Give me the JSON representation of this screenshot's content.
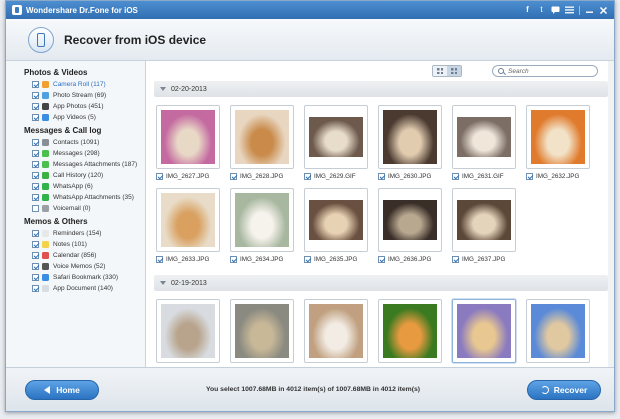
{
  "window": {
    "title": "Wondershare Dr.Fone for iOS",
    "icons": [
      "facebook-icon",
      "twitter-icon",
      "chat-icon",
      "menu-icon",
      "minimize-icon",
      "close-icon"
    ]
  },
  "header": {
    "title": "Recover from iOS device"
  },
  "search": {
    "placeholder": "Search"
  },
  "sidebar": {
    "sections": [
      {
        "title": "Photos & Videos",
        "items": [
          {
            "label": "Camera Roll (117)",
            "checked": true,
            "selected": true,
            "icon": "camera-roll-icon",
            "color": "#f0a030"
          },
          {
            "label": "Photo Stream (69)",
            "checked": true,
            "icon": "photo-stream-icon",
            "color": "#4ea0e0"
          },
          {
            "label": "App Photos (451)",
            "checked": true,
            "icon": "app-photos-icon",
            "color": "#444444"
          },
          {
            "label": "App Videos (5)",
            "checked": true,
            "icon": "app-videos-icon",
            "color": "#3a8de0"
          }
        ]
      },
      {
        "title": "Messages & Call log",
        "items": [
          {
            "label": "Contacts (1091)",
            "checked": true,
            "icon": "contacts-icon",
            "color": "#8a8f96"
          },
          {
            "label": "Messages (298)",
            "checked": true,
            "icon": "messages-icon",
            "color": "#4cc04c"
          },
          {
            "label": "Messages Attachments (187)",
            "checked": true,
            "icon": "attachments-icon",
            "color": "#4cc04c"
          },
          {
            "label": "Call History (120)",
            "checked": true,
            "icon": "call-history-icon",
            "color": "#3cb043"
          },
          {
            "label": "WhatsApp (6)",
            "checked": true,
            "icon": "whatsapp-icon",
            "color": "#2fb34a"
          },
          {
            "label": "WhatsApp Attachments (35)",
            "checked": true,
            "icon": "whatsapp-attachments-icon",
            "color": "#2fb34a"
          },
          {
            "label": "Voicemail (0)",
            "checked": false,
            "icon": "voicemail-icon",
            "color": "#9aa0a6"
          }
        ]
      },
      {
        "title": "Memos & Others",
        "items": [
          {
            "label": "Reminders (154)",
            "checked": true,
            "icon": "reminders-icon",
            "color": "#e8e8e8"
          },
          {
            "label": "Notes (101)",
            "checked": true,
            "icon": "notes-icon",
            "color": "#f2d34a"
          },
          {
            "label": "Calendar (856)",
            "checked": true,
            "icon": "calendar-icon",
            "color": "#e05050"
          },
          {
            "label": "Voice Memos (52)",
            "checked": true,
            "icon": "voice-memos-icon",
            "color": "#555555"
          },
          {
            "label": "Safari Bookmark (330)",
            "checked": true,
            "icon": "safari-icon",
            "color": "#3a8de0"
          },
          {
            "label": "App Document (140)",
            "checked": true,
            "icon": "app-document-icon",
            "color": "#d8dde2"
          }
        ]
      }
    ]
  },
  "groups": [
    {
      "date": "02-20-2013",
      "rows": [
        [
          {
            "name": "IMG_2627.JPG",
            "bg": "#c46aa0",
            "fg": "#e8d8c6"
          },
          {
            "name": "IMG_2628.JPG",
            "bg": "#e8d6c0",
            "fg": "#c98a4a"
          },
          {
            "name": "IMG_2629.GIF",
            "bg": "#6d5a4c",
            "fg": "#e8dccb",
            "wide": true
          },
          {
            "name": "IMG_2630.JPG",
            "bg": "#4a3a30",
            "fg": "#e2ccb0"
          },
          {
            "name": "IMG_2631.GIF",
            "bg": "#7c6e64",
            "fg": "#f0e6da",
            "wide": true
          },
          {
            "name": "IMG_2632.JPG",
            "bg": "#e07a2c",
            "fg": "#f2e2c8"
          }
        ],
        [
          {
            "name": "IMG_2633.JPG",
            "bg": "#e8dcc8",
            "fg": "#d9a060"
          },
          {
            "name": "IMG_2634.JPG",
            "bg": "#a8b8a0",
            "fg": "#f6f2ec"
          },
          {
            "name": "IMG_2635.JPG",
            "bg": "#6a5040",
            "fg": "#e8d2b4",
            "wide": true
          },
          {
            "name": "IMG_2636.JPG",
            "bg": "#3a2e28",
            "fg": "#b8a890",
            "wide": true
          },
          {
            "name": "IMG_2637.JPG",
            "bg": "#5c4838",
            "fg": "#e4d4bc",
            "wide": true
          }
        ]
      ]
    },
    {
      "date": "02-19-2013",
      "rows": [
        [
          {
            "bg": "#d8dce0",
            "fg": "#b8a48c"
          },
          {
            "bg": "#8a8a80",
            "fg": "#c8b898"
          },
          {
            "bg": "#c0a080",
            "fg": "#f2ece4"
          },
          {
            "bg": "#3a7a20",
            "fg": "#e89a40"
          },
          {
            "bg": "#8a7ac0",
            "fg": "#e8c890",
            "selected": true
          },
          {
            "bg": "#5a8ad8",
            "fg": "#e0c8a0"
          }
        ]
      ]
    }
  ],
  "footer": {
    "home_label": "Home",
    "recover_label": "Recover",
    "status": "You select 1007.68MB in 4012 item(s) of 1007.68MB in 4012 item(s)"
  }
}
